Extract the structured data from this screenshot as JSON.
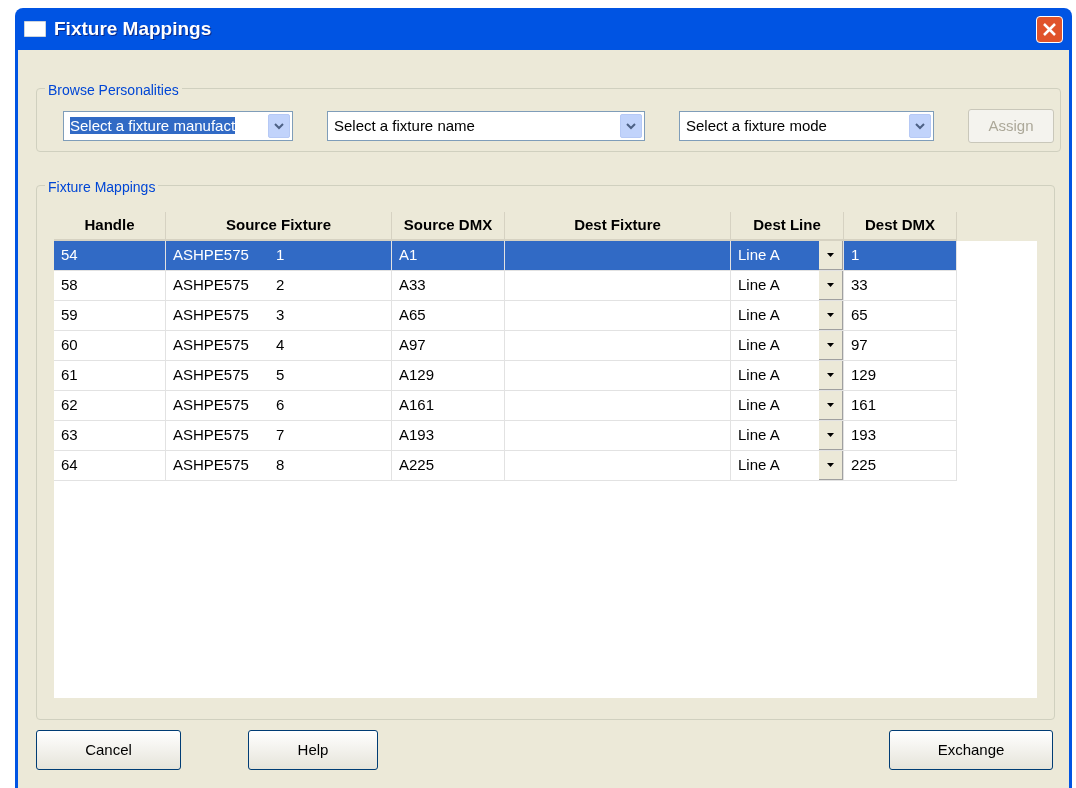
{
  "window": {
    "title": "Fixture Mappings"
  },
  "browse": {
    "label": "Browse Personalities",
    "combos": [
      {
        "value": "Select a fixture manufact",
        "focused": true
      },
      {
        "value": "Select a fixture name",
        "focused": false
      },
      {
        "value": "Select a fixture mode",
        "focused": false
      }
    ],
    "assign": {
      "label": "Assign",
      "disabled": true
    }
  },
  "mappings": {
    "label": "Fixture Mappings",
    "columns": [
      "Handle",
      "Source Fixture",
      "Source DMX",
      "Dest Fixture",
      "Dest Line",
      "Dest DMX"
    ],
    "rows": [
      {
        "handle": "54",
        "fixture": "ASHPE575",
        "number": "1",
        "source_dmx": "A1",
        "dest_line": "Line A",
        "dest_dmx": "1",
        "selected": true
      },
      {
        "handle": "58",
        "fixture": "ASHPE575",
        "number": "2",
        "source_dmx": "A33",
        "dest_line": "Line A",
        "dest_dmx": "33",
        "selected": false
      },
      {
        "handle": "59",
        "fixture": "ASHPE575",
        "number": "3",
        "source_dmx": "A65",
        "dest_line": "Line A",
        "dest_dmx": "65",
        "selected": false
      },
      {
        "handle": "60",
        "fixture": "ASHPE575",
        "number": "4",
        "source_dmx": "A97",
        "dest_line": "Line A",
        "dest_dmx": "97",
        "selected": false
      },
      {
        "handle": "61",
        "fixture": "ASHPE575",
        "number": "5",
        "source_dmx": "A129",
        "dest_line": "Line A",
        "dest_dmx": "129",
        "selected": false
      },
      {
        "handle": "62",
        "fixture": "ASHPE575",
        "number": "6",
        "source_dmx": "A161",
        "dest_line": "Line A",
        "dest_dmx": "161",
        "selected": false
      },
      {
        "handle": "63",
        "fixture": "ASHPE575",
        "number": "7",
        "source_dmx": "A193",
        "dest_line": "Line A",
        "dest_dmx": "193",
        "selected": false
      },
      {
        "handle": "64",
        "fixture": "ASHPE575",
        "number": "8",
        "source_dmx": "A225",
        "dest_line": "Line A",
        "dest_dmx": "225",
        "selected": false
      }
    ]
  },
  "left_buttons": [
    "Cancel",
    "Help"
  ],
  "right_buttons": [
    "Exchange"
  ]
}
